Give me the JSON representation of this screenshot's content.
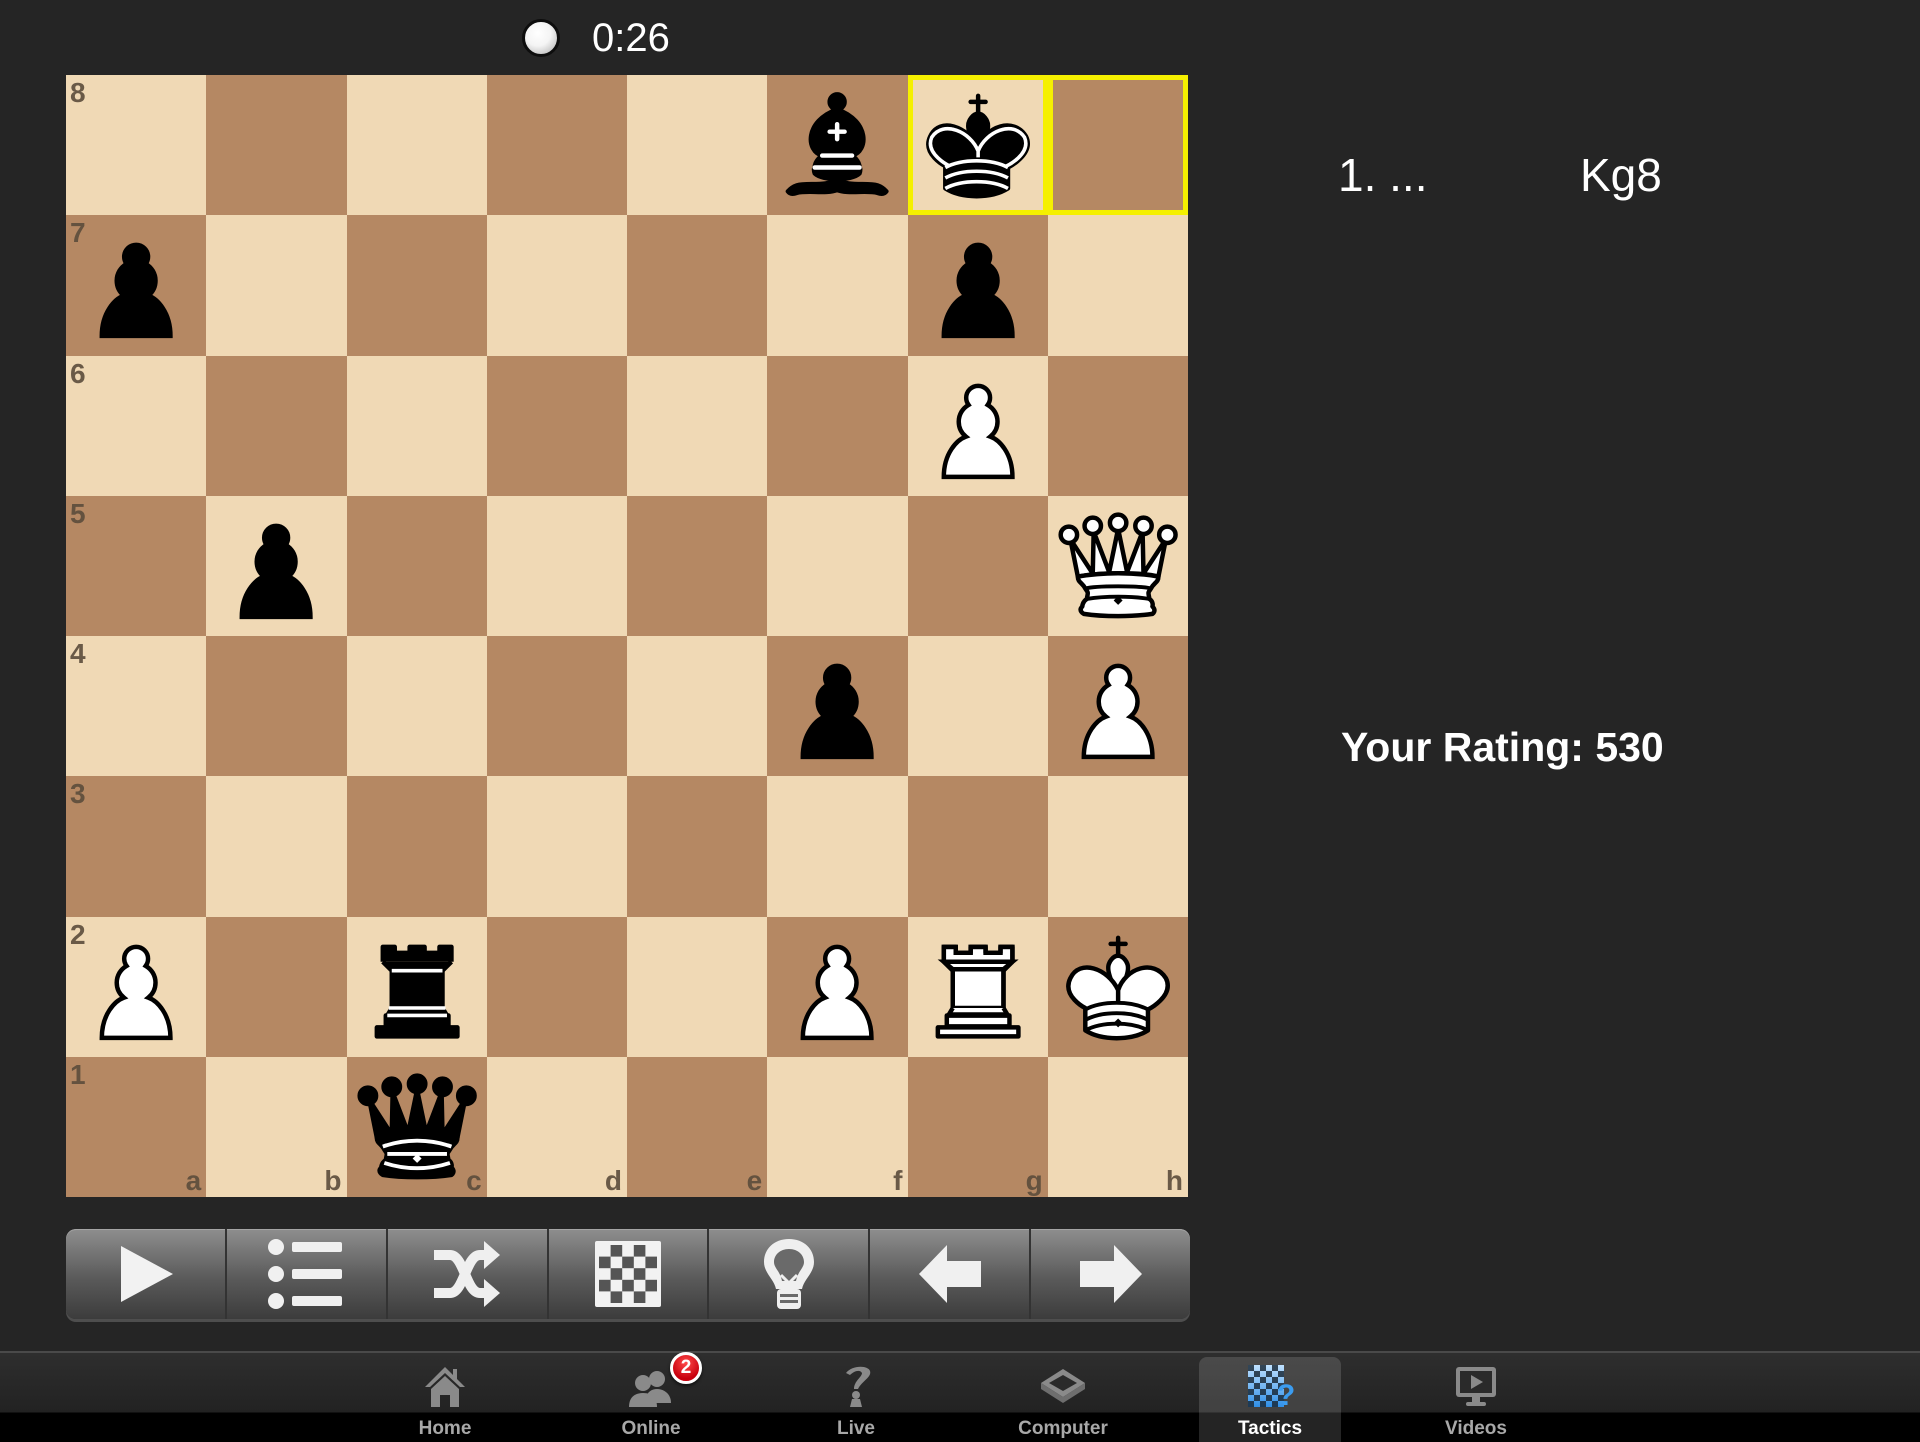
{
  "timer": {
    "side_to_move": "white",
    "time": "0:26"
  },
  "board": {
    "colors": {
      "light": "#f0d9b5",
      "dark": "#b58863",
      "highlight": "#f5f000"
    },
    "ranks": [
      "8",
      "7",
      "6",
      "5",
      "4",
      "3",
      "2",
      "1"
    ],
    "files": [
      "a",
      "b",
      "c",
      "d",
      "e",
      "f",
      "g",
      "h"
    ],
    "highlighted_squares": [
      "g8",
      "h8"
    ],
    "pieces": [
      {
        "square": "f8",
        "color": "black",
        "type": "bishop"
      },
      {
        "square": "g8",
        "color": "black",
        "type": "king"
      },
      {
        "square": "a7",
        "color": "black",
        "type": "pawn"
      },
      {
        "square": "g7",
        "color": "black",
        "type": "pawn"
      },
      {
        "square": "g6",
        "color": "white",
        "type": "pawn"
      },
      {
        "square": "b5",
        "color": "black",
        "type": "pawn"
      },
      {
        "square": "h5",
        "color": "white",
        "type": "queen"
      },
      {
        "square": "f4",
        "color": "black",
        "type": "pawn"
      },
      {
        "square": "h4",
        "color": "white",
        "type": "pawn"
      },
      {
        "square": "a2",
        "color": "white",
        "type": "pawn"
      },
      {
        "square": "c2",
        "color": "black",
        "type": "rook"
      },
      {
        "square": "f2",
        "color": "white",
        "type": "pawn"
      },
      {
        "square": "g2",
        "color": "white",
        "type": "rook"
      },
      {
        "square": "h2",
        "color": "white",
        "type": "king"
      },
      {
        "square": "c1",
        "color": "black",
        "type": "queen"
      }
    ]
  },
  "toolbar": {
    "buttons": [
      {
        "name": "play",
        "icon": "play-icon"
      },
      {
        "name": "move-list",
        "icon": "list-icon"
      },
      {
        "name": "shuffle",
        "icon": "shuffle-icon"
      },
      {
        "name": "board",
        "icon": "checkerboard-icon"
      },
      {
        "name": "hint",
        "icon": "lightbulb-icon"
      },
      {
        "name": "back",
        "icon": "arrow-left-icon"
      },
      {
        "name": "forward",
        "icon": "arrow-right-icon"
      }
    ]
  },
  "moves": {
    "number": "1. ...",
    "san": "Kg8"
  },
  "rating": {
    "text": "Your Rating: 530"
  },
  "tabbar": {
    "tabs": [
      {
        "label": "Home",
        "icon": "home-icon"
      },
      {
        "label": "Online",
        "icon": "users-icon",
        "badge": "2"
      },
      {
        "label": "Live",
        "icon": "live-icon"
      },
      {
        "label": "Computer",
        "icon": "chip-icon"
      },
      {
        "label": "Tactics",
        "icon": "tactics-icon",
        "active": true
      },
      {
        "label": "Videos",
        "icon": "video-icon"
      }
    ]
  }
}
